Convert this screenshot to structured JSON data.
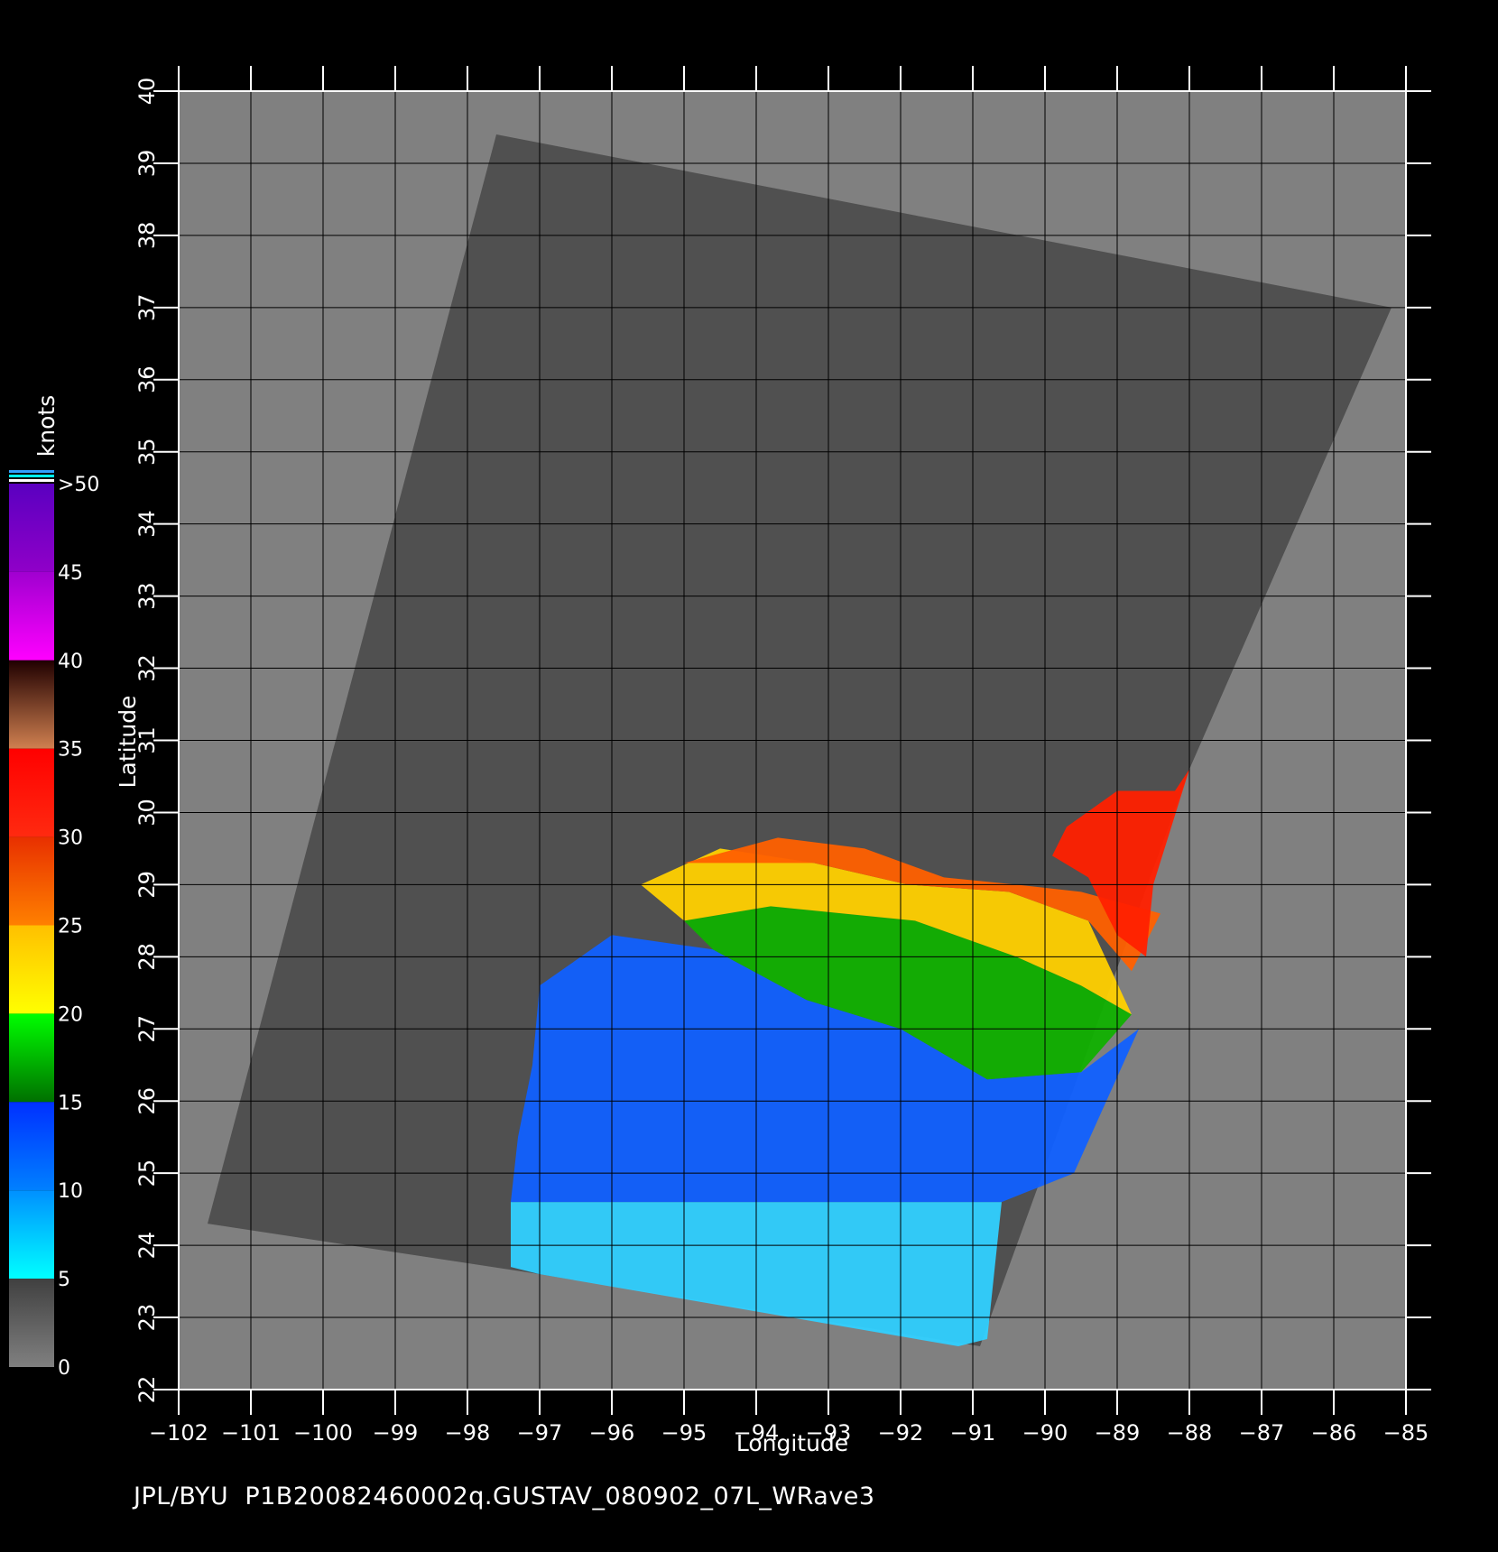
{
  "map": {
    "footer_text": "JPL/BYU  P1B20082460002q.GUSTAV_080902_07L_WRave3",
    "xlabel": "Longitude",
    "ylabel": "Latitude",
    "lon_range": [
      -102,
      -85
    ],
    "lat_range": [
      22,
      40
    ],
    "lon_ticks": [
      "−102",
      "−101",
      "−100",
      "−99",
      "−98",
      "−97",
      "−96",
      "−95",
      "−94",
      "−93",
      "−92",
      "−91",
      "−90",
      "−89",
      "−88",
      "−87",
      "−86",
      "−85"
    ],
    "lat_ticks": [
      "22",
      "23",
      "24",
      "25",
      "26",
      "27",
      "28",
      "29",
      "30",
      "31",
      "32",
      "33",
      "34",
      "35",
      "36",
      "37",
      "38",
      "39",
      "40"
    ],
    "background_color": "#808080",
    "swath_color": "#505050",
    "swath_corners": [
      [
        -97.6,
        39.4
      ],
      [
        -85.2,
        37.0
      ],
      [
        -88.0,
        30.6
      ],
      [
        -90.9,
        22.6
      ],
      [
        -97.0,
        23.6
      ],
      [
        -101.6,
        24.3
      ]
    ],
    "grid": true
  },
  "colorbar": {
    "title": "knots",
    "labels": [
      ">50",
      "45",
      "40",
      "35",
      "30",
      "25",
      "20",
      "15",
      "10",
      "5",
      "0"
    ],
    "bands": [
      {
        "from": 50,
        "to": 45,
        "top": "#5a00c0",
        "bottom": "#9000c8"
      },
      {
        "from": 45,
        "to": 40,
        "top": "#a000d0",
        "bottom": "#ff00ff"
      },
      {
        "from": 40,
        "to": 35,
        "top": "#200000",
        "bottom": "#d08050"
      },
      {
        "from": 35,
        "to": 30,
        "top": "#ff0000",
        "bottom": "#ff2a10"
      },
      {
        "from": 30,
        "to": 25,
        "top": "#e83000",
        "bottom": "#ff8000"
      },
      {
        "from": 25,
        "to": 20,
        "top": "#ffc000",
        "bottom": "#ffff00"
      },
      {
        "from": 20,
        "to": 15,
        "top": "#00ff00",
        "bottom": "#007000"
      },
      {
        "from": 15,
        "to": 10,
        "top": "#0030ff",
        "bottom": "#0080ff"
      },
      {
        "from": 10,
        "to": 5,
        "top": "#0090ff",
        "bottom": "#00ffff"
      },
      {
        "from": 5,
        "to": 0,
        "top": "#404040",
        "bottom": "#808080"
      }
    ]
  },
  "wind_regions": [
    {
      "name": "speed-5-10",
      "color": "#30d0ff",
      "polygon": [
        [
          -97.4,
          24.6
        ],
        [
          -90.6,
          24.6
        ],
        [
          -90.8,
          22.7
        ],
        [
          -91.2,
          22.6
        ],
        [
          -97.0,
          23.6
        ],
        [
          -97.4,
          23.7
        ]
      ]
    },
    {
      "name": "speed-10-15",
      "color": "#1060ff",
      "polygon": [
        [
          -97.0,
          27.6
        ],
        [
          -96.0,
          28.3
        ],
        [
          -94.6,
          28.1
        ],
        [
          -93.3,
          27.4
        ],
        [
          -92.0,
          27.0
        ],
        [
          -90.8,
          26.3
        ],
        [
          -89.5,
          26.4
        ],
        [
          -88.7,
          27.0
        ],
        [
          -89.6,
          25.0
        ],
        [
          -90.6,
          24.6
        ],
        [
          -97.4,
          24.6
        ],
        [
          -97.3,
          25.5
        ],
        [
          -97.1,
          26.5
        ]
      ]
    },
    {
      "name": "speed-15-20",
      "color": "#10b000",
      "polygon": [
        [
          -95.0,
          28.5
        ],
        [
          -93.8,
          28.7
        ],
        [
          -91.8,
          28.5
        ],
        [
          -90.4,
          28.0
        ],
        [
          -89.5,
          27.6
        ],
        [
          -88.8,
          27.2
        ],
        [
          -89.5,
          26.4
        ],
        [
          -90.8,
          26.3
        ],
        [
          -92.0,
          27.0
        ],
        [
          -93.3,
          27.4
        ],
        [
          -94.6,
          28.1
        ]
      ]
    },
    {
      "name": "speed-20-25",
      "color": "#ffd000",
      "polygon": [
        [
          -95.6,
          29.0
        ],
        [
          -94.5,
          29.5
        ],
        [
          -93.2,
          29.3
        ],
        [
          -91.9,
          29.0
        ],
        [
          -90.5,
          28.9
        ],
        [
          -89.4,
          28.5
        ],
        [
          -88.8,
          27.2
        ],
        [
          -89.5,
          27.6
        ],
        [
          -90.4,
          28.0
        ],
        [
          -91.8,
          28.5
        ],
        [
          -93.8,
          28.7
        ],
        [
          -95.0,
          28.5
        ]
      ]
    },
    {
      "name": "speed-25-30",
      "color": "#ff6000",
      "polygon": [
        [
          -95.0,
          29.3
        ],
        [
          -93.7,
          29.65
        ],
        [
          -92.5,
          29.5
        ],
        [
          -91.4,
          29.1
        ],
        [
          -90.4,
          29.0
        ],
        [
          -89.5,
          28.9
        ],
        [
          -88.4,
          28.6
        ],
        [
          -88.8,
          27.8
        ],
        [
          -89.4,
          28.5
        ],
        [
          -90.5,
          28.9
        ],
        [
          -91.9,
          29.0
        ],
        [
          -93.2,
          29.3
        ]
      ]
    },
    {
      "name": "speed-30-35",
      "color": "#ff2000",
      "polygon": [
        [
          -89.7,
          29.8
        ],
        [
          -89.0,
          30.3
        ],
        [
          -88.2,
          30.3
        ],
        [
          -88.0,
          30.6
        ],
        [
          -88.5,
          29.0
        ],
        [
          -88.6,
          28.0
        ],
        [
          -89.0,
          28.3
        ],
        [
          -89.4,
          29.1
        ],
        [
          -89.9,
          29.4
        ]
      ]
    }
  ]
}
